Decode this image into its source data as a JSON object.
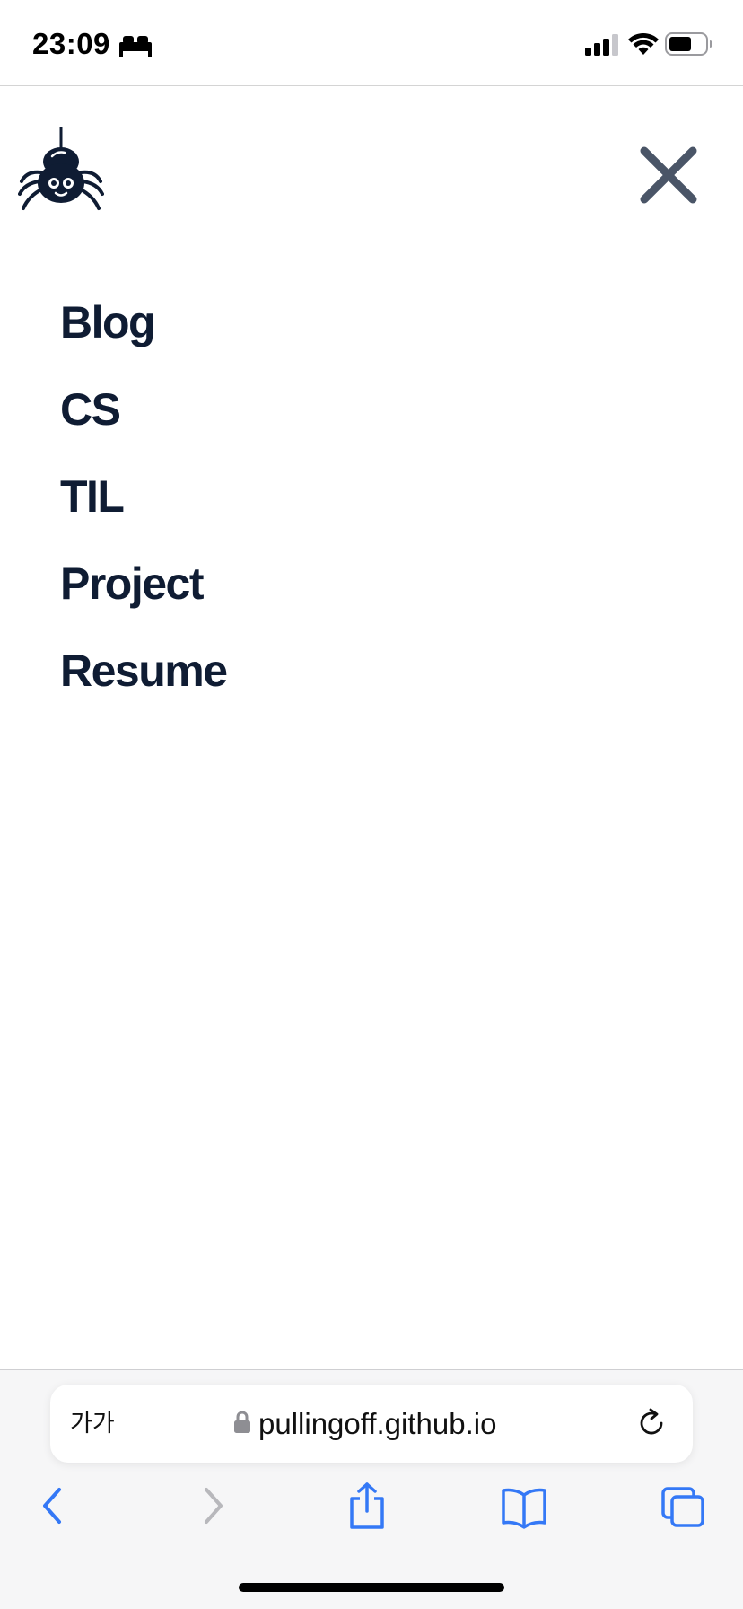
{
  "status_bar": {
    "time": "23:09",
    "icons": [
      "bed-sleep-icon",
      "cellular-signal-icon",
      "wifi-icon",
      "battery-icon"
    ]
  },
  "header": {
    "logo_icon": "spider-logo-icon",
    "close_icon": "close-x-icon"
  },
  "nav": {
    "items": [
      {
        "label": "Blog"
      },
      {
        "label": "CS"
      },
      {
        "label": "TIL"
      },
      {
        "label": "Project"
      },
      {
        "label": "Resume"
      }
    ]
  },
  "browser": {
    "text_size_label": "가가",
    "url": "pullingoff.github.io",
    "toolbar_icons": [
      "back-icon",
      "forward-icon",
      "share-icon",
      "bookmarks-icon",
      "tabs-icon"
    ]
  },
  "colors": {
    "nav_text": "#0f1c33",
    "close_icon": "#4a5567",
    "browser_accent": "#3478f6",
    "disabled_icon": "#b8b8bc"
  }
}
